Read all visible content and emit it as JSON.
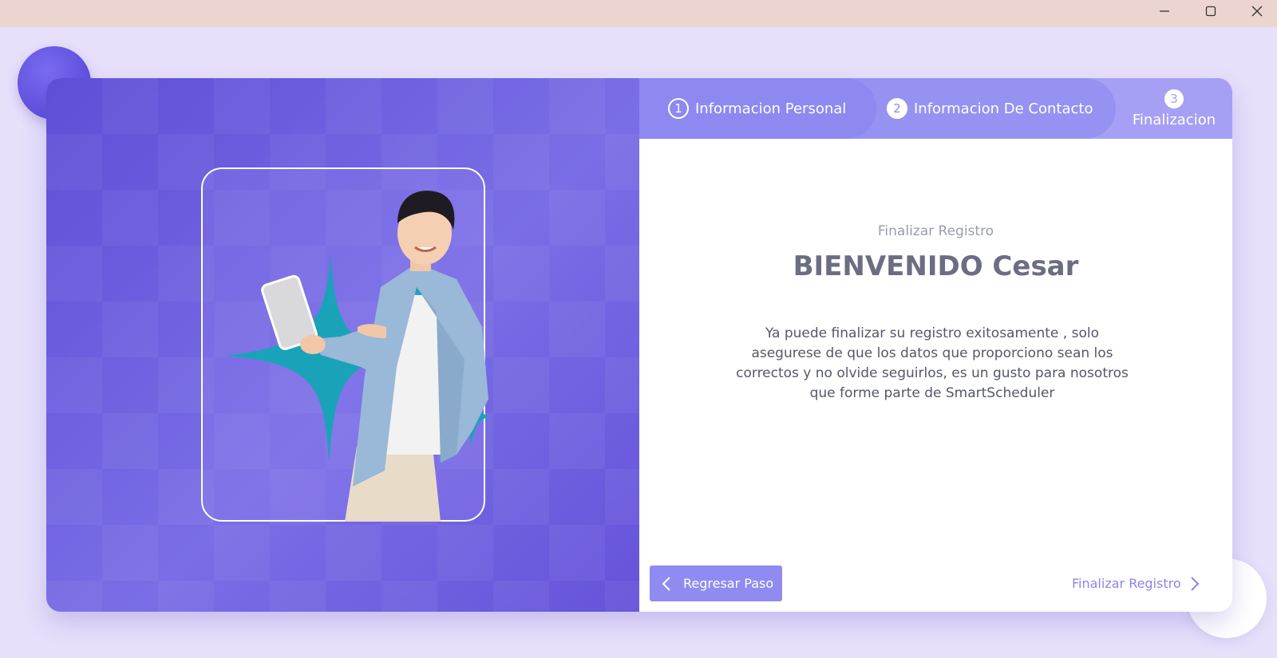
{
  "window": {
    "minimize_icon": "minimize-icon",
    "maximize_icon": "maximize-icon",
    "close_icon": "close-icon"
  },
  "steps": [
    {
      "number": "1",
      "label": "Informacion Personal"
    },
    {
      "number": "2",
      "label": "Informacion De Contacto"
    },
    {
      "number": "3",
      "label": "Finalizacion"
    }
  ],
  "content": {
    "subtitle": "Finalizar Registro",
    "headline": "BIENVENIDO Cesar",
    "message": "Ya puede finalizar su registro exitosamente , solo asegurese de que los datos que proporciono sean los correctos y no olvide seguirlos, es un gusto para nosotros que forme parte de SmartScheduler"
  },
  "buttons": {
    "back_label": "Regresar  Paso",
    "finish_label": "Finalizar Registro"
  },
  "colors": {
    "accent": "#8d89f1",
    "left_panel": "#6a5bdc",
    "sparkle": "#1aa3b8"
  }
}
